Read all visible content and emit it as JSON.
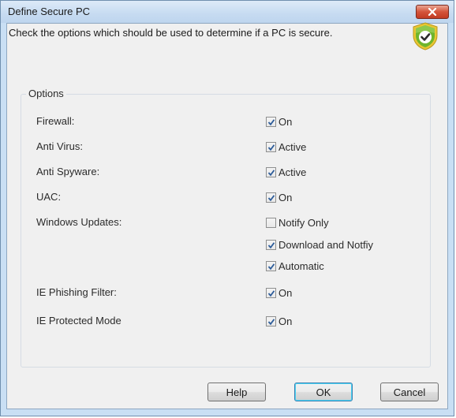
{
  "window": {
    "title": "Define Secure PC"
  },
  "intro_text": "Check the options which should be used to determine if a PC is secure.",
  "group": {
    "label": "Options"
  },
  "options": {
    "firewall": {
      "label": "Firewall:",
      "choices": [
        {
          "text": "On",
          "checked": true
        }
      ]
    },
    "antivirus": {
      "label": "Anti Virus:",
      "choices": [
        {
          "text": "Active",
          "checked": true
        }
      ]
    },
    "antispyware": {
      "label": "Anti Spyware:",
      "choices": [
        {
          "text": "Active",
          "checked": true
        }
      ]
    },
    "uac": {
      "label": "UAC:",
      "choices": [
        {
          "text": "On",
          "checked": true
        }
      ]
    },
    "windows_updates": {
      "label": "Windows Updates:",
      "choices": [
        {
          "text": "Notify Only",
          "checked": false
        },
        {
          "text": "Download and Notfiy",
          "checked": true
        },
        {
          "text": "Automatic",
          "checked": true
        }
      ]
    },
    "ie_phishing": {
      "label": "IE Phishing Filter:",
      "choices": [
        {
          "text": "On",
          "checked": true
        }
      ]
    },
    "ie_protected": {
      "label": "IE Protected Mode",
      "choices": [
        {
          "text": "On",
          "checked": true
        }
      ]
    }
  },
  "buttons": {
    "help": "Help",
    "ok": "OK",
    "cancel": "Cancel"
  },
  "icons": {
    "close": "close-icon",
    "shield": "shield-check-icon",
    "checkmark": "checkmark-icon"
  },
  "colors": {
    "close_button": "#c7432a",
    "shield_green": "#6fb52c",
    "shield_rim": "#e9c633"
  }
}
